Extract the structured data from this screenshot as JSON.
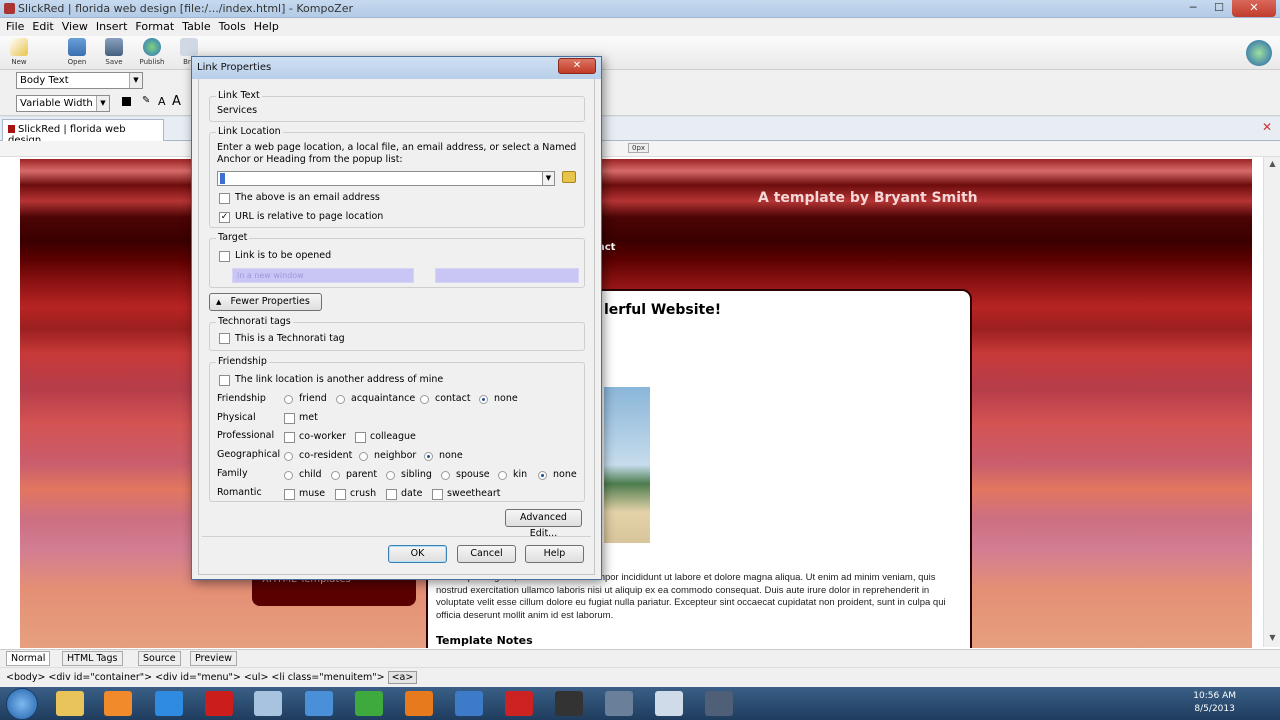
{
  "window": {
    "title": "SlickRed | florida web design [file:/.../index.html] - KompoZer",
    "minimize": "─",
    "maximize": "☐",
    "close": "✕"
  },
  "menu": [
    "File",
    "Edit",
    "View",
    "Insert",
    "Format",
    "Table",
    "Tools",
    "Help"
  ],
  "toolbar": {
    "items": [
      {
        "label": "New",
        "icon": "new-icon"
      },
      {
        "label": "Open",
        "icon": "open-icon"
      },
      {
        "label": "Save",
        "icon": "save-icon"
      },
      {
        "label": "Publish",
        "icon": "publish-icon"
      },
      {
        "label": "Bro",
        "icon": "browse-icon"
      }
    ]
  },
  "format": {
    "paragraph_style": "Body Text",
    "font": "Variable Width"
  },
  "doc_tab": {
    "label": "SlickRed | florida web design"
  },
  "ruler": {
    "unit": "0px"
  },
  "page": {
    "template_credit": "A template by Bryant Smith",
    "nav_fragment": "act",
    "heading_fragment": "lerful Website!",
    "lorem": "etur adipisicing elit, sed do eiusmod tempor incididunt ut labore et dolore magna aliqua. Ut enim ad minim veniam, quis nostrud exercitation ullamco laboris nisi ut aliquip ex ea commodo consequat. Duis aute irure dolor in reprehenderit in voluptate velit esse cillum dolore eu fugiat nulla pariatur. Excepteur sint occaecat cupidatat non proident, sunt in culpa qui officia deserunt mollit anim id est laborum.",
    "notes_heading": "Template Notes",
    "sidebox": "XHTML Templates"
  },
  "modes": [
    "Normal",
    "HTML Tags",
    "Source",
    "Preview"
  ],
  "status_path": "<body> <div id=\"container\"> <div id=\"menu\"> <ul> <li class=\"menuitem\">",
  "status_active": "<a>",
  "tray": {
    "time": "10:56 AM",
    "date": "8/5/2013"
  },
  "dialog": {
    "title": "Link Properties",
    "close": "✕",
    "link_text": {
      "legend": "Link Text",
      "value": "Services"
    },
    "link_location": {
      "legend": "Link Location",
      "instructions": "Enter a web page location, a local file, an email address, or select a Named Anchor or Heading from the popup list:",
      "url_value": "",
      "email_label": "The above is an email address",
      "email_checked": false,
      "relative_label": "URL is relative to page location",
      "relative_checked": true
    },
    "target": {
      "legend": "Target",
      "label": "Link is to be opened",
      "select": "in a new window"
    },
    "fewer_properties": "Fewer Properties",
    "technorati": {
      "legend": "Technorati tags",
      "label": "This is a Technorati tag"
    },
    "friendship": {
      "legend": "Friendship",
      "another_address": "The link location is another address of mine",
      "rows": [
        {
          "label": "Friendship",
          "options": [
            {
              "text": "friend",
              "kind": "radio",
              "on": false
            },
            {
              "text": "acquaintance",
              "kind": "radio",
              "on": false
            },
            {
              "text": "contact",
              "kind": "radio",
              "on": false
            },
            {
              "text": "none",
              "kind": "radio",
              "on": true
            }
          ]
        },
        {
          "label": "Physical",
          "options": [
            {
              "text": "met",
              "kind": "check",
              "on": false
            }
          ]
        },
        {
          "label": "Professional",
          "options": [
            {
              "text": "co-worker",
              "kind": "check",
              "on": false
            },
            {
              "text": "colleague",
              "kind": "check",
              "on": false
            }
          ]
        },
        {
          "label": "Geographical",
          "options": [
            {
              "text": "co-resident",
              "kind": "radio",
              "on": false
            },
            {
              "text": "neighbor",
              "kind": "radio",
              "on": false
            },
            {
              "text": "none",
              "kind": "radio",
              "on": true
            }
          ]
        },
        {
          "label": "Family",
          "options": [
            {
              "text": "child",
              "kind": "radio",
              "on": false
            },
            {
              "text": "parent",
              "kind": "radio",
              "on": false
            },
            {
              "text": "sibling",
              "kind": "radio",
              "on": false
            },
            {
              "text": "spouse",
              "kind": "radio",
              "on": false
            },
            {
              "text": "kin",
              "kind": "radio",
              "on": false
            },
            {
              "text": "none",
              "kind": "radio",
              "on": true
            }
          ]
        },
        {
          "label": "Romantic",
          "options": [
            {
              "text": "muse",
              "kind": "check",
              "on": false
            },
            {
              "text": "crush",
              "kind": "check",
              "on": false
            },
            {
              "text": "date",
              "kind": "check",
              "on": false
            },
            {
              "text": "sweetheart",
              "kind": "check",
              "on": false
            }
          ]
        }
      ]
    },
    "advanced_edit": "Advanced Edit...",
    "ok": "OK",
    "cancel": "Cancel",
    "help": "Help"
  }
}
